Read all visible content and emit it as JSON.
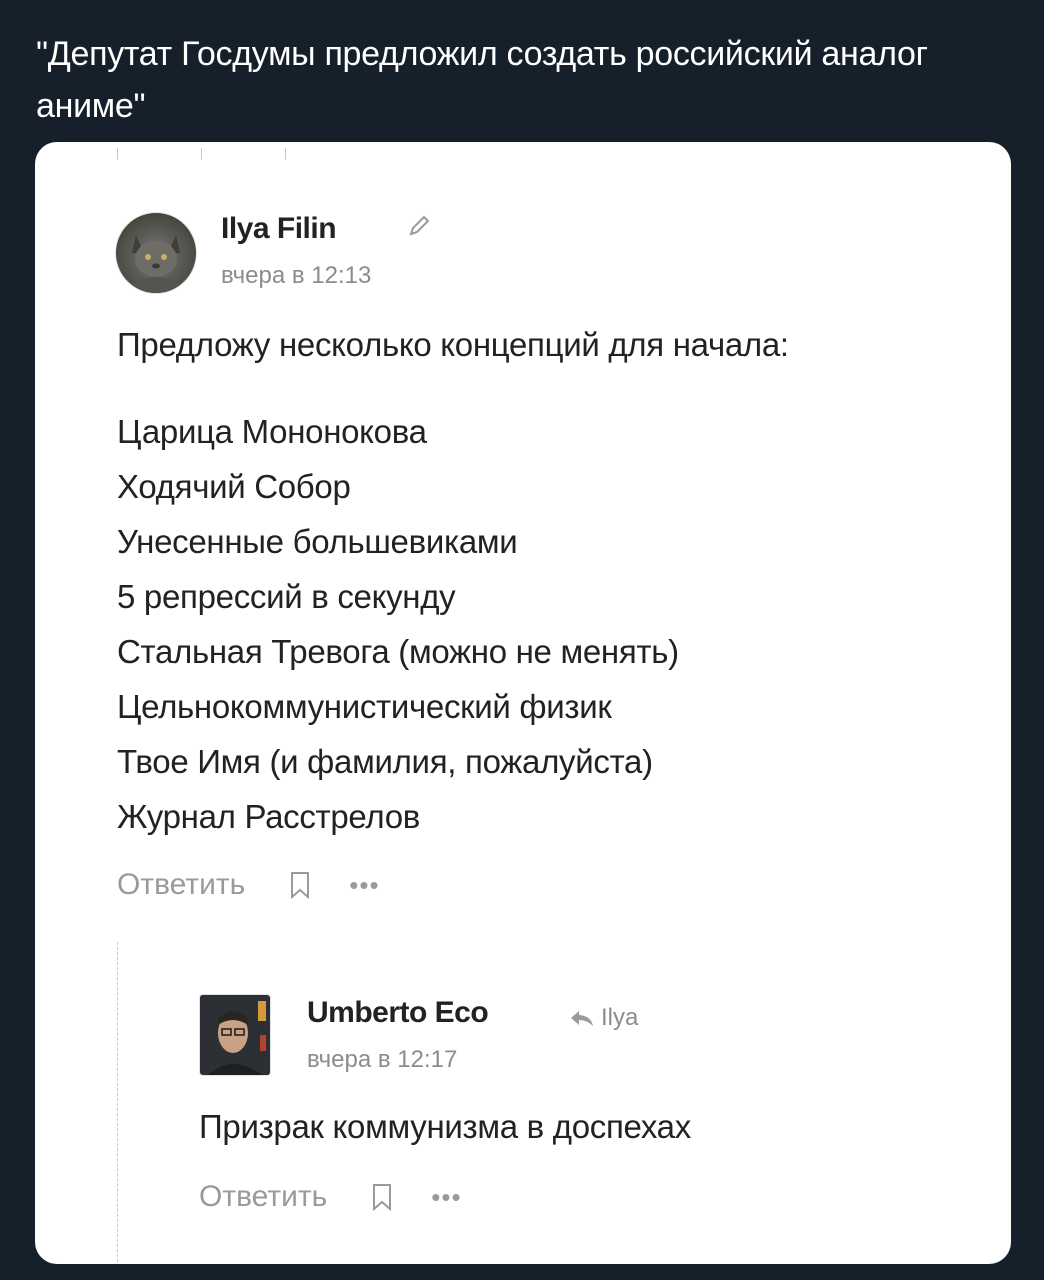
{
  "tweet": {
    "text": "\"Депутат Госдумы предложил создать российский аналог аниме\""
  },
  "post": {
    "author": "Ilya Filin",
    "avatar_icon": "cat-avatar",
    "edit_icon": "pencil-icon",
    "timestamp": "вчера в 12:13",
    "intro": "Предложу несколько концепций для начала:",
    "concepts": [
      "Царица Мононокова",
      "Ходячий Собор",
      "Унесенные большевиками",
      "5 репрессий в секунду",
      "Стальная Тревога (можно не менять)",
      "Цельнокоммунистический физик",
      "Твое Имя (и фамилия, пожалуйста)",
      "Журнал Расстрелов"
    ],
    "reply_label": "Ответить",
    "bookmark_icon": "bookmark-icon",
    "more_label": "•••"
  },
  "reply": {
    "author": "Umberto Eco",
    "reply_to_icon": "reply-arrow-icon",
    "reply_to": "Ilya",
    "timestamp": "вчера в 12:17",
    "text": "Призрак коммунизма в доспехах",
    "reply_label": "Ответить",
    "bookmark_icon": "bookmark-icon",
    "more_label": "•••"
  },
  "colors": {
    "background": "#15202b",
    "card": "#ffffff",
    "text": "#222222",
    "muted": "#8c8c8c"
  }
}
